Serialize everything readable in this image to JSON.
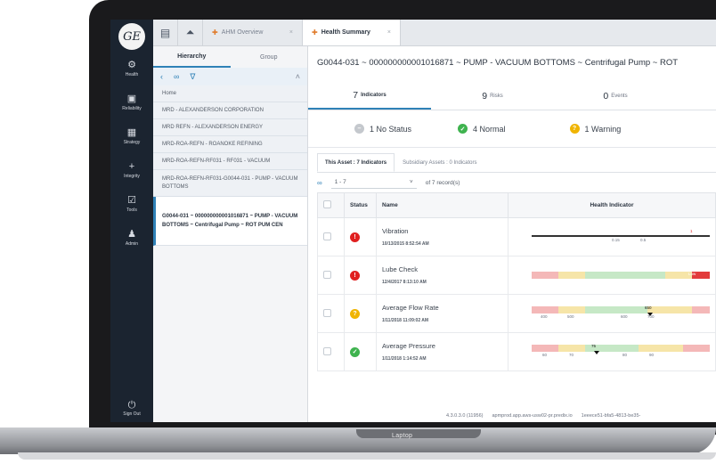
{
  "device": {
    "base_label": "Laptop"
  },
  "nav": {
    "logo": "GE",
    "items": [
      {
        "icon": "⚙",
        "label": "Health"
      },
      {
        "icon": "▣",
        "label": "Reliability"
      },
      {
        "icon": "▦",
        "label": "Strategy"
      },
      {
        "icon": "+",
        "label": "Integrity"
      },
      {
        "icon": "☑",
        "label": "Tools"
      },
      {
        "icon": "♟",
        "label": "Admin"
      }
    ],
    "signout": {
      "icon": "⏻",
      "label": "Sign Out"
    }
  },
  "tabs": [
    {
      "label": "AHM Overview"
    },
    {
      "label": "Health Summary"
    }
  ],
  "hierarchy": {
    "tabs": [
      "Hierarchy",
      "Group"
    ],
    "rows": [
      "Home",
      "MRD - ALEXANDERSON CORPORATION",
      "MRD REFN - ALEXANDERSON ENERGY",
      "MRD-ROA-REFN - ROANOKE REFINING",
      "MRD-ROA-REFN-RF031 - RF031 - VACUUM",
      "MRD-ROA-REFN-RF031-G0044-031 - PUMP - VACUUM BOTTOMS"
    ],
    "selected": "G0044-031 ~ 000000000001016871 ~ PUMP - VACUUM BOTTOMS ~ Centrifugal Pump ~ ROT PUM CEN"
  },
  "main": {
    "title": "G0044-031 ~ 000000000001016871 ~ PUMP - VACUUM BOTTOMS ~ Centrifugal Pump ~ ROT",
    "counts": [
      {
        "n": "7",
        "label": "Indicators"
      },
      {
        "n": "9",
        "label": "Risks"
      },
      {
        "n": "0",
        "label": "Events"
      }
    ],
    "statuses": [
      {
        "label": "1 No Status",
        "color": "#c4c8cd",
        "glyph": "–"
      },
      {
        "label": "4 Normal",
        "color": "#3fb34f",
        "glyph": "✓"
      },
      {
        "label": "1 Warning",
        "color": "#f0b400",
        "glyph": "?"
      }
    ],
    "subtabs": [
      "This Asset : 7 Indicators",
      "Subsidiary Assets : 0 Indicators"
    ],
    "pager": {
      "range": "1 - 7",
      "of": "of 7 record(s)"
    },
    "columns": [
      "Status",
      "Name",
      "Health Indicator"
    ],
    "rows": [
      {
        "name": "Vibration",
        "date": "10/13/2015 8:52:54 AM",
        "status_color": "#e02020",
        "glyph": "!",
        "ticks": [
          "0.15",
          "0.5"
        ],
        "value": "1"
      },
      {
        "name": "Lube Check",
        "date": "12/4/2017 8:13:10 AM",
        "status_color": "#e02020",
        "glyph": "!",
        "ticks": [],
        "value": "Low"
      },
      {
        "name": "Average Flow Rate",
        "date": "1/11/2018 11:09:02 AM",
        "status_color": "#f0b400",
        "glyph": "?",
        "ticks": [
          "400",
          "500",
          "600",
          "700"
        ],
        "value": "650"
      },
      {
        "name": "Average Pressure",
        "date": "1/11/2018 1:14:52 AM",
        "status_color": "#3fb34f",
        "glyph": "✓",
        "ticks": [
          "60",
          "70",
          "80",
          "90"
        ],
        "value": "75"
      }
    ]
  },
  "footer": {
    "version": "4.3.0.3.0 (11956)",
    "host": "apmprod.app.aws-usw02-pr.predix.io",
    "tenant": "1eeece51-bfa5-4813-be35-"
  }
}
